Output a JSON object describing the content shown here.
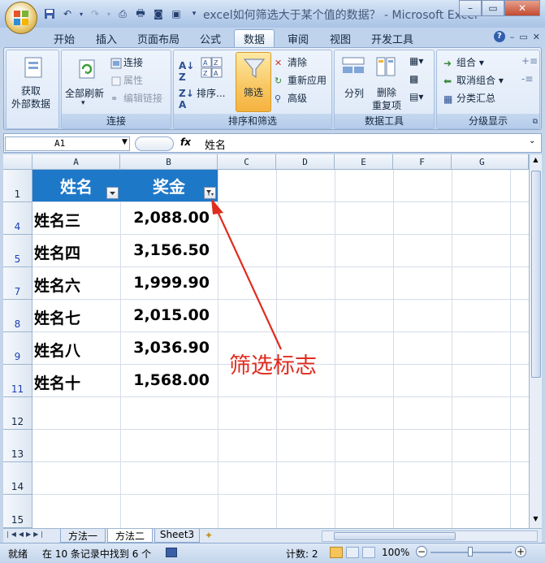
{
  "window": {
    "title": "excel如何筛选大于某个值的数据？ - Microsoft Excel"
  },
  "ribbon_tabs": [
    "开始",
    "插入",
    "页面布局",
    "公式",
    "数据",
    "审阅",
    "视图",
    "开发工具"
  ],
  "active_tab": "数据",
  "ribbon": {
    "get_external": "获取\n外部数据",
    "refresh_all": "全部刷新",
    "connections": "连接",
    "properties": "属性",
    "edit_links": "编辑链接",
    "group_connections": "连接",
    "sort_label": "排序...",
    "filter_label": "筛选",
    "clear_label": "清除",
    "reapply_label": "重新应用",
    "advanced_label": "高级",
    "group_sort_filter": "排序和筛选",
    "text_to_columns": "分列",
    "remove_duplicates": "删除\n重复项",
    "group_data_tools": "数据工具",
    "group_label": "组合",
    "ungroup_label": "取消组合",
    "subtotal_label": "分类汇总",
    "group_outline": "分级显示"
  },
  "formula_bar": {
    "name_box": "A1",
    "fx": "fx",
    "value": "姓名"
  },
  "columns": [
    "A",
    "B",
    "C",
    "D",
    "E",
    "F",
    "G"
  ],
  "header_row": {
    "row_num": "1",
    "col_a": "姓名",
    "col_b": "奖金"
  },
  "rows": [
    {
      "row_num": "4",
      "name": "姓名三",
      "bonus": "2,088.00"
    },
    {
      "row_num": "5",
      "name": "姓名四",
      "bonus": "3,156.50"
    },
    {
      "row_num": "7",
      "name": "姓名六",
      "bonus": "1,999.90"
    },
    {
      "row_num": "8",
      "name": "姓名七",
      "bonus": "2,015.00"
    },
    {
      "row_num": "9",
      "name": "姓名八",
      "bonus": "3,036.90"
    },
    {
      "row_num": "11",
      "name": "姓名十",
      "bonus": "1,568.00"
    },
    {
      "row_num": "12",
      "name": "",
      "bonus": ""
    },
    {
      "row_num": "13",
      "name": "",
      "bonus": ""
    },
    {
      "row_num": "14",
      "name": "",
      "bonus": ""
    },
    {
      "row_num": "15",
      "name": "",
      "bonus": ""
    }
  ],
  "annotation": "筛选标志",
  "sheet_tabs": [
    "方法一",
    "方法二",
    "Sheet3"
  ],
  "active_sheet": "方法二",
  "status_bar": {
    "ready": "就绪",
    "found": "在 10 条记录中找到 6 个",
    "count": "计数: 2",
    "zoom": "100%"
  },
  "colors": {
    "header_fill": "#1e78c8",
    "annotation_red": "#e02c1f"
  }
}
